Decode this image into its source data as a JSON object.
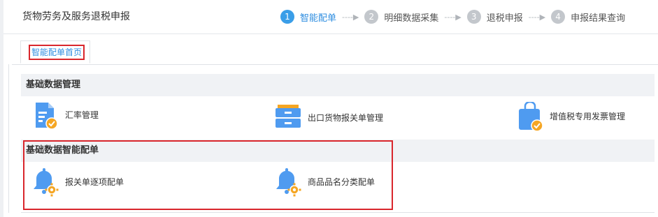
{
  "header": {
    "title": "货物劳务及服务退税申报",
    "steps": [
      {
        "num": "1",
        "label": "智能配单",
        "active": true
      },
      {
        "num": "2",
        "label": "明细数据采集",
        "active": false
      },
      {
        "num": "3",
        "label": "退税申报",
        "active": false
      },
      {
        "num": "4",
        "label": "申报结果查询",
        "active": false
      }
    ],
    "arrow": "----▶"
  },
  "tabs": [
    {
      "label": "智能配单首页"
    }
  ],
  "sections": [
    {
      "title": "基础数据管理",
      "items": [
        {
          "label": "汇率管理",
          "icon": "document-check-icon"
        },
        {
          "label": "出口货物报关单管理",
          "icon": "cabinet-icon"
        },
        {
          "label": "增值税专用发票管理",
          "icon": "bag-check-icon"
        }
      ]
    },
    {
      "title": "基础数据智能配单",
      "items": [
        {
          "label": "报关单逐项配单",
          "icon": "bell-gear-icon"
        },
        {
          "label": "商品品名分类配单",
          "icon": "bell-gear-icon"
        }
      ]
    }
  ],
  "colors": {
    "accent": "#3a9ee8",
    "icon_blue": "#4f9bf0",
    "icon_orange": "#f5a623",
    "highlight_red": "#d9262c"
  }
}
